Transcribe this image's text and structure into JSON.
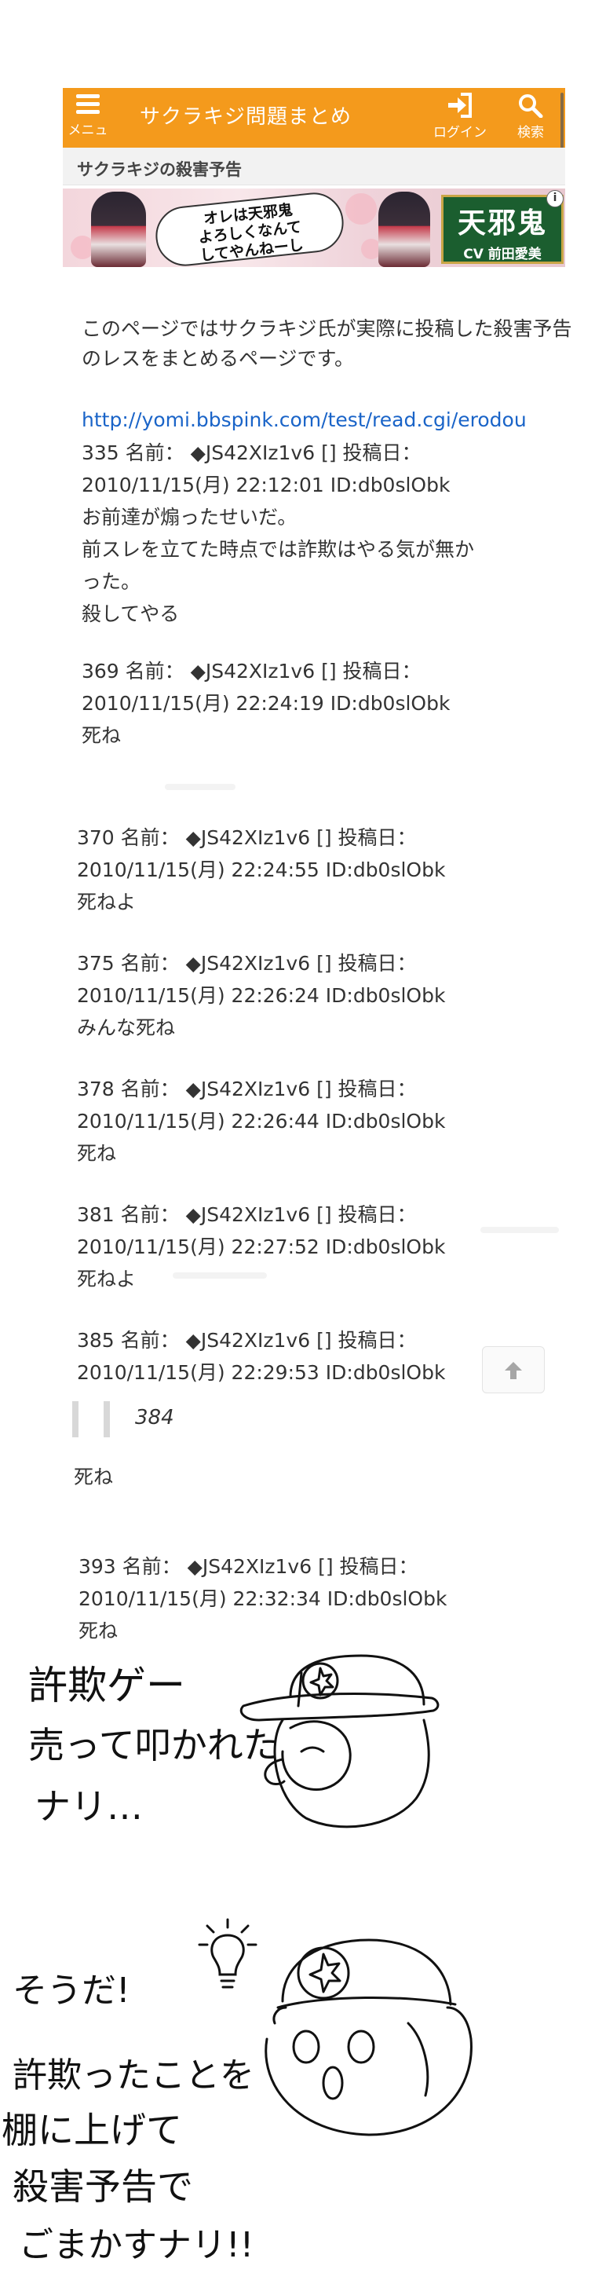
{
  "header": {
    "menu_label": "メニュー",
    "title": "サクラキジ問題まとめ",
    "login_label": "ログイン",
    "search_label": "検索"
  },
  "subheader": {
    "title": "サクラキジの殺害予告"
  },
  "ad": {
    "catch_lines": [
      "オレは天邪鬼",
      "よろしくなんて",
      "してやんねーし"
    ],
    "logo_title": "天邪鬼",
    "logo_cv": "CV 前田愛美",
    "info_badge": "i"
  },
  "intro": "このページではサクラキジ氏が実際に投稿した殺害予告のレスをまとめるページです。",
  "link": "http://yomi.bbspink.com/test/read.cgi/erodou",
  "posts": [
    {
      "header": "335 名前： ◆JS42XIz1v6 [] 投稿日：",
      "date": "2010/11/15(月) 22:12:01 ID:db0slObk",
      "body": [
        "お前達が煽ったせいだ。",
        "前スレを立てた時点では詐欺はやる気が無か",
        "った。",
        "殺してやる"
      ]
    },
    {
      "header": "369 名前： ◆JS42XIz1v6 [] 投稿日：",
      "date": "2010/11/15(月) 22:24:19 ID:db0slObk",
      "body": [
        "死ね"
      ]
    },
    {
      "header": "370 名前： ◆JS42XIz1v6 [] 投稿日：",
      "date": "2010/11/15(月) 22:24:55 ID:db0slObk",
      "body": [
        "死ねよ"
      ]
    },
    {
      "header": "375 名前： ◆JS42XIz1v6 [] 投稿日：",
      "date": "2010/11/15(月) 22:26:24 ID:db0slObk",
      "body": [
        "みんな死ね"
      ]
    },
    {
      "header": "378 名前： ◆JS42XIz1v6 [] 投稿日：",
      "date": "2010/11/15(月) 22:26:44 ID:db0slObk",
      "body": [
        "死ね"
      ]
    },
    {
      "header": "381 名前： ◆JS42XIz1v6 [] 投稿日：",
      "date": "2010/11/15(月) 22:27:52 ID:db0slObk",
      "body": [
        "死ねよ"
      ]
    },
    {
      "header": "385 名前： ◆JS42XIz1v6 [] 投稿日：",
      "date": "2010/11/15(月) 22:29:53 ID:db0slObk",
      "quote": "384",
      "body": [
        "死ね"
      ]
    },
    {
      "header": "393 名前： ◆JS42XIz1v6 [] 投稿日：",
      "date": "2010/11/15(月) 22:32:34 ID:db0slObk",
      "body": [
        "死ね"
      ]
    }
  ],
  "drawing1": {
    "lines": [
      "許欺ゲー",
      "売って叩かれた",
      "ナリ…"
    ]
  },
  "drawing2": {
    "lines": [
      "そうだ!",
      "許欺ったことを",
      "棚に上げて",
      "殺害予告で",
      "ごまかすナリ!!"
    ]
  }
}
